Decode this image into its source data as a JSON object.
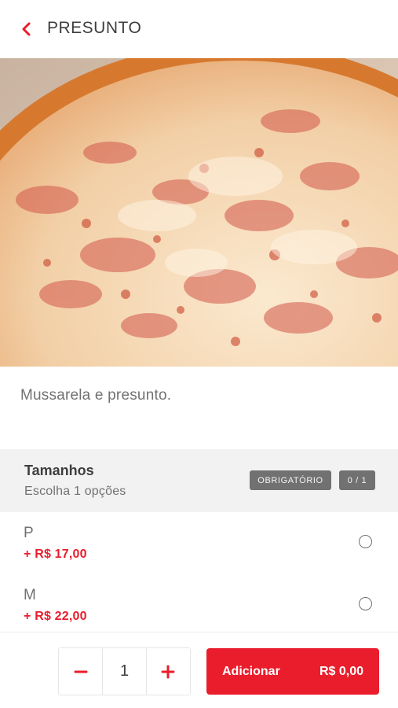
{
  "header": {
    "title": "PRESUNTO",
    "back_icon": "chevron-left-icon"
  },
  "hero": {
    "alt": "pizza-image"
  },
  "product": {
    "description": "Mussarela e presunto."
  },
  "group": {
    "title": "Tamanhos",
    "subtitle": "Escolha 1 opções",
    "required_label": "OBRIGATÓRIO",
    "count_label": "0 / 1"
  },
  "options": [
    {
      "name": "P",
      "price": "+ R$ 17,00",
      "selected": false
    },
    {
      "name": "M",
      "price": "+ R$ 22,00",
      "selected": false
    }
  ],
  "footer": {
    "quantity": "1",
    "minus_icon": "minus-icon",
    "plus_icon": "plus-icon",
    "add_label": "Adicionar",
    "add_price": "R$ 0,00"
  },
  "colors": {
    "accent": "#ea1d2c",
    "text": "#3f3e3e",
    "muted": "#717171",
    "group_bg": "#f2f2f2"
  }
}
